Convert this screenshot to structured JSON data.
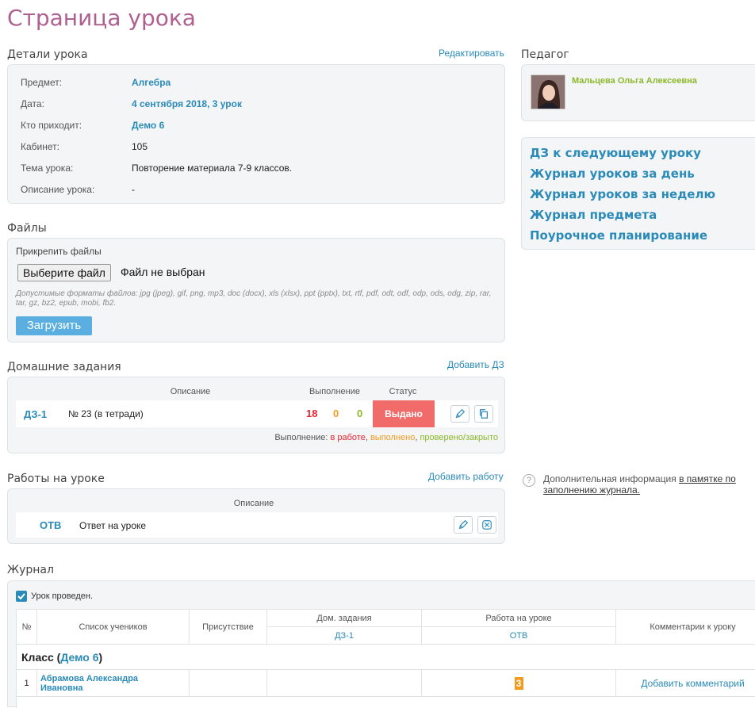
{
  "page": {
    "title": "Страница урока"
  },
  "lesson_details": {
    "section_title": "Детали урока",
    "edit_link": "Редактировать",
    "rows": [
      {
        "label": "Предмет:",
        "value": "Алгебра",
        "link": true
      },
      {
        "label": "Дата:",
        "value": "4 сентября 2018, 3 урок",
        "link": true
      },
      {
        "label": "Кто приходит:",
        "value": "Демо 6",
        "link": true
      },
      {
        "label": "Кабинет:",
        "value": "105",
        "link": false
      },
      {
        "label": "Тема урока:",
        "value": "Повторение материала 7-9 классов.",
        "link": false
      },
      {
        "label": "Описание урока:",
        "value": "-",
        "link": false
      }
    ]
  },
  "files": {
    "section_title": "Файлы",
    "attach_label": "Прикрепить файлы",
    "choose_button": "Выберите файл",
    "no_file": "Файл не выбран",
    "formats": "Допустимые форматы файлов: jpg (jpeg), gif, png, mp3, doc (docx), xls (xlsx), ppt (pptx), txt, rtf, pdf, odt, odf, odp, ods, odg, zip, rar, tar, gz, bz2, epub, mobi, fb2.",
    "upload_button": "Загрузить"
  },
  "homework": {
    "section_title": "Домашние задания",
    "add_link": "Добавить ДЗ",
    "col_description": "Описание",
    "col_completion": "Выполнение",
    "col_status": "Статус",
    "row": {
      "code": "ДЗ-1",
      "description": "№ 23 (в тетради)",
      "in_progress": "18",
      "done": "0",
      "checked": "0",
      "status": "Выдано"
    },
    "legend_prefix": "Выполнение:",
    "legend_in_progress": "в работе",
    "legend_done": "выполнено",
    "legend_checked": "проверено/закрыто",
    "colors": {
      "in_progress": "#e8252e",
      "done": "#f39a1f",
      "checked": "#8cb82a",
      "status_bg": "#f26b6b"
    }
  },
  "classwork": {
    "section_title": "Работы на уроке",
    "add_link": "Добавить работу",
    "col_description": "Описание",
    "row": {
      "code": "ОТВ",
      "description": "Ответ на уроке"
    }
  },
  "journal": {
    "section_title": "Журнал",
    "lesson_held": "Урок проведен.",
    "lesson_held_checked": true,
    "headers": {
      "number": "№",
      "students": "Список учеников",
      "attendance": "Присутствие",
      "homework": "Дом. задания",
      "homework_sub": "ДЗ-1",
      "classwork": "Работа на уроке",
      "classwork_sub": "ОТВ",
      "comments": "Комментарии к уроку"
    },
    "class_prefix": "Класс (",
    "class_name": "Демо 6",
    "class_suffix": ")",
    "students": [
      {
        "number": "1",
        "name_line1": "Абрамова Александра",
        "name_line2": "Ивановна",
        "grade": "3",
        "comment_link": "Добавить комментарий"
      }
    ],
    "grade_color": "#f39a1f"
  },
  "teacher": {
    "section_title": "Педагог",
    "name": "Мальцева Ольга Алексеевна",
    "name_color": "#8cb82a"
  },
  "quick_links": [
    "ДЗ к следующему уроку",
    "Журнал уроков за день",
    "Журнал уроков за неделю",
    "Журнал предмета",
    "Поурочное планирование"
  ],
  "help": {
    "text": "Дополнительная информация ",
    "link_line1": "в памятке по",
    "link_line2": "заполнению журнала."
  }
}
